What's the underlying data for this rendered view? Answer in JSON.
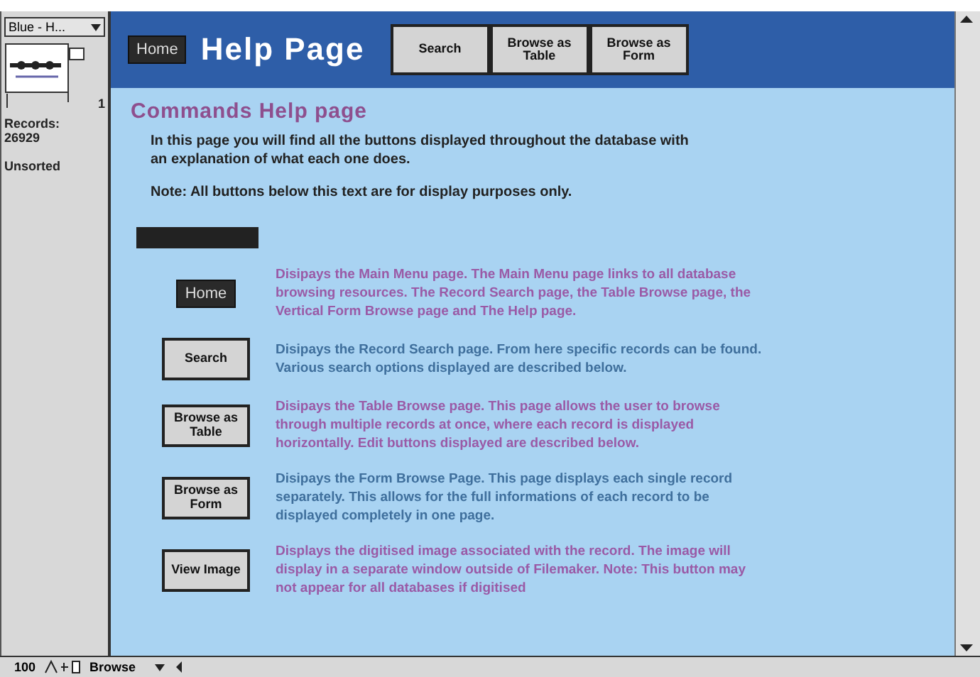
{
  "status_area": {
    "layout_menu": "Blue - H...",
    "page_number": "1",
    "records_label": "Records:",
    "records_count": "26929",
    "sort_state": "Unsorted"
  },
  "header": {
    "home_button": "Home",
    "title": "Help Page",
    "nav_buttons": [
      {
        "label": "Search"
      },
      {
        "label": "Browse as Table"
      },
      {
        "label": "Browse as Form"
      }
    ]
  },
  "content": {
    "heading": "Commands Help page",
    "intro": "In this page you will find all the buttons displayed throughout the database with an explanation of what each one does.",
    "note": "Note: All buttons below this text are for display purposes only.",
    "commands": [
      {
        "button": "Home",
        "kind": "dark",
        "color": "#9a5aa6",
        "description": "Disipays the Main Menu page. The Main Menu page links to all database browsing resources. The Record Search page, the Table Browse page, the Vertical Form Browse page and The Help page."
      },
      {
        "button": "Search",
        "kind": "light",
        "color": "#3f6f9c",
        "description": "Disipays the Record Search page. From here specific records can be found. Various search options displayed are described below."
      },
      {
        "button": "Browse as Table",
        "kind": "light",
        "color": "#9a5aa6",
        "description": "Disipays the Table Browse page. This page allows the user to browse through multiple records at once, where each record is displayed horizontally. Edit buttons displayed are described below."
      },
      {
        "button": "Browse as Form",
        "kind": "light",
        "color": "#3f6f9c",
        "description": "Disipays the Form Browse Page. This page displays each single record separately. This allows for the full informations of each record to be displayed completely in one page."
      },
      {
        "button": "View Image",
        "kind": "light",
        "color": "#9a5aa6",
        "description": "Displays the digitised image associated with the record. The image will display in a separate window outside of Filemaker. Note: This button may not appear for all databases if digitised"
      }
    ]
  },
  "bottom_bar": {
    "zoom": "100",
    "mode": "Browse"
  }
}
